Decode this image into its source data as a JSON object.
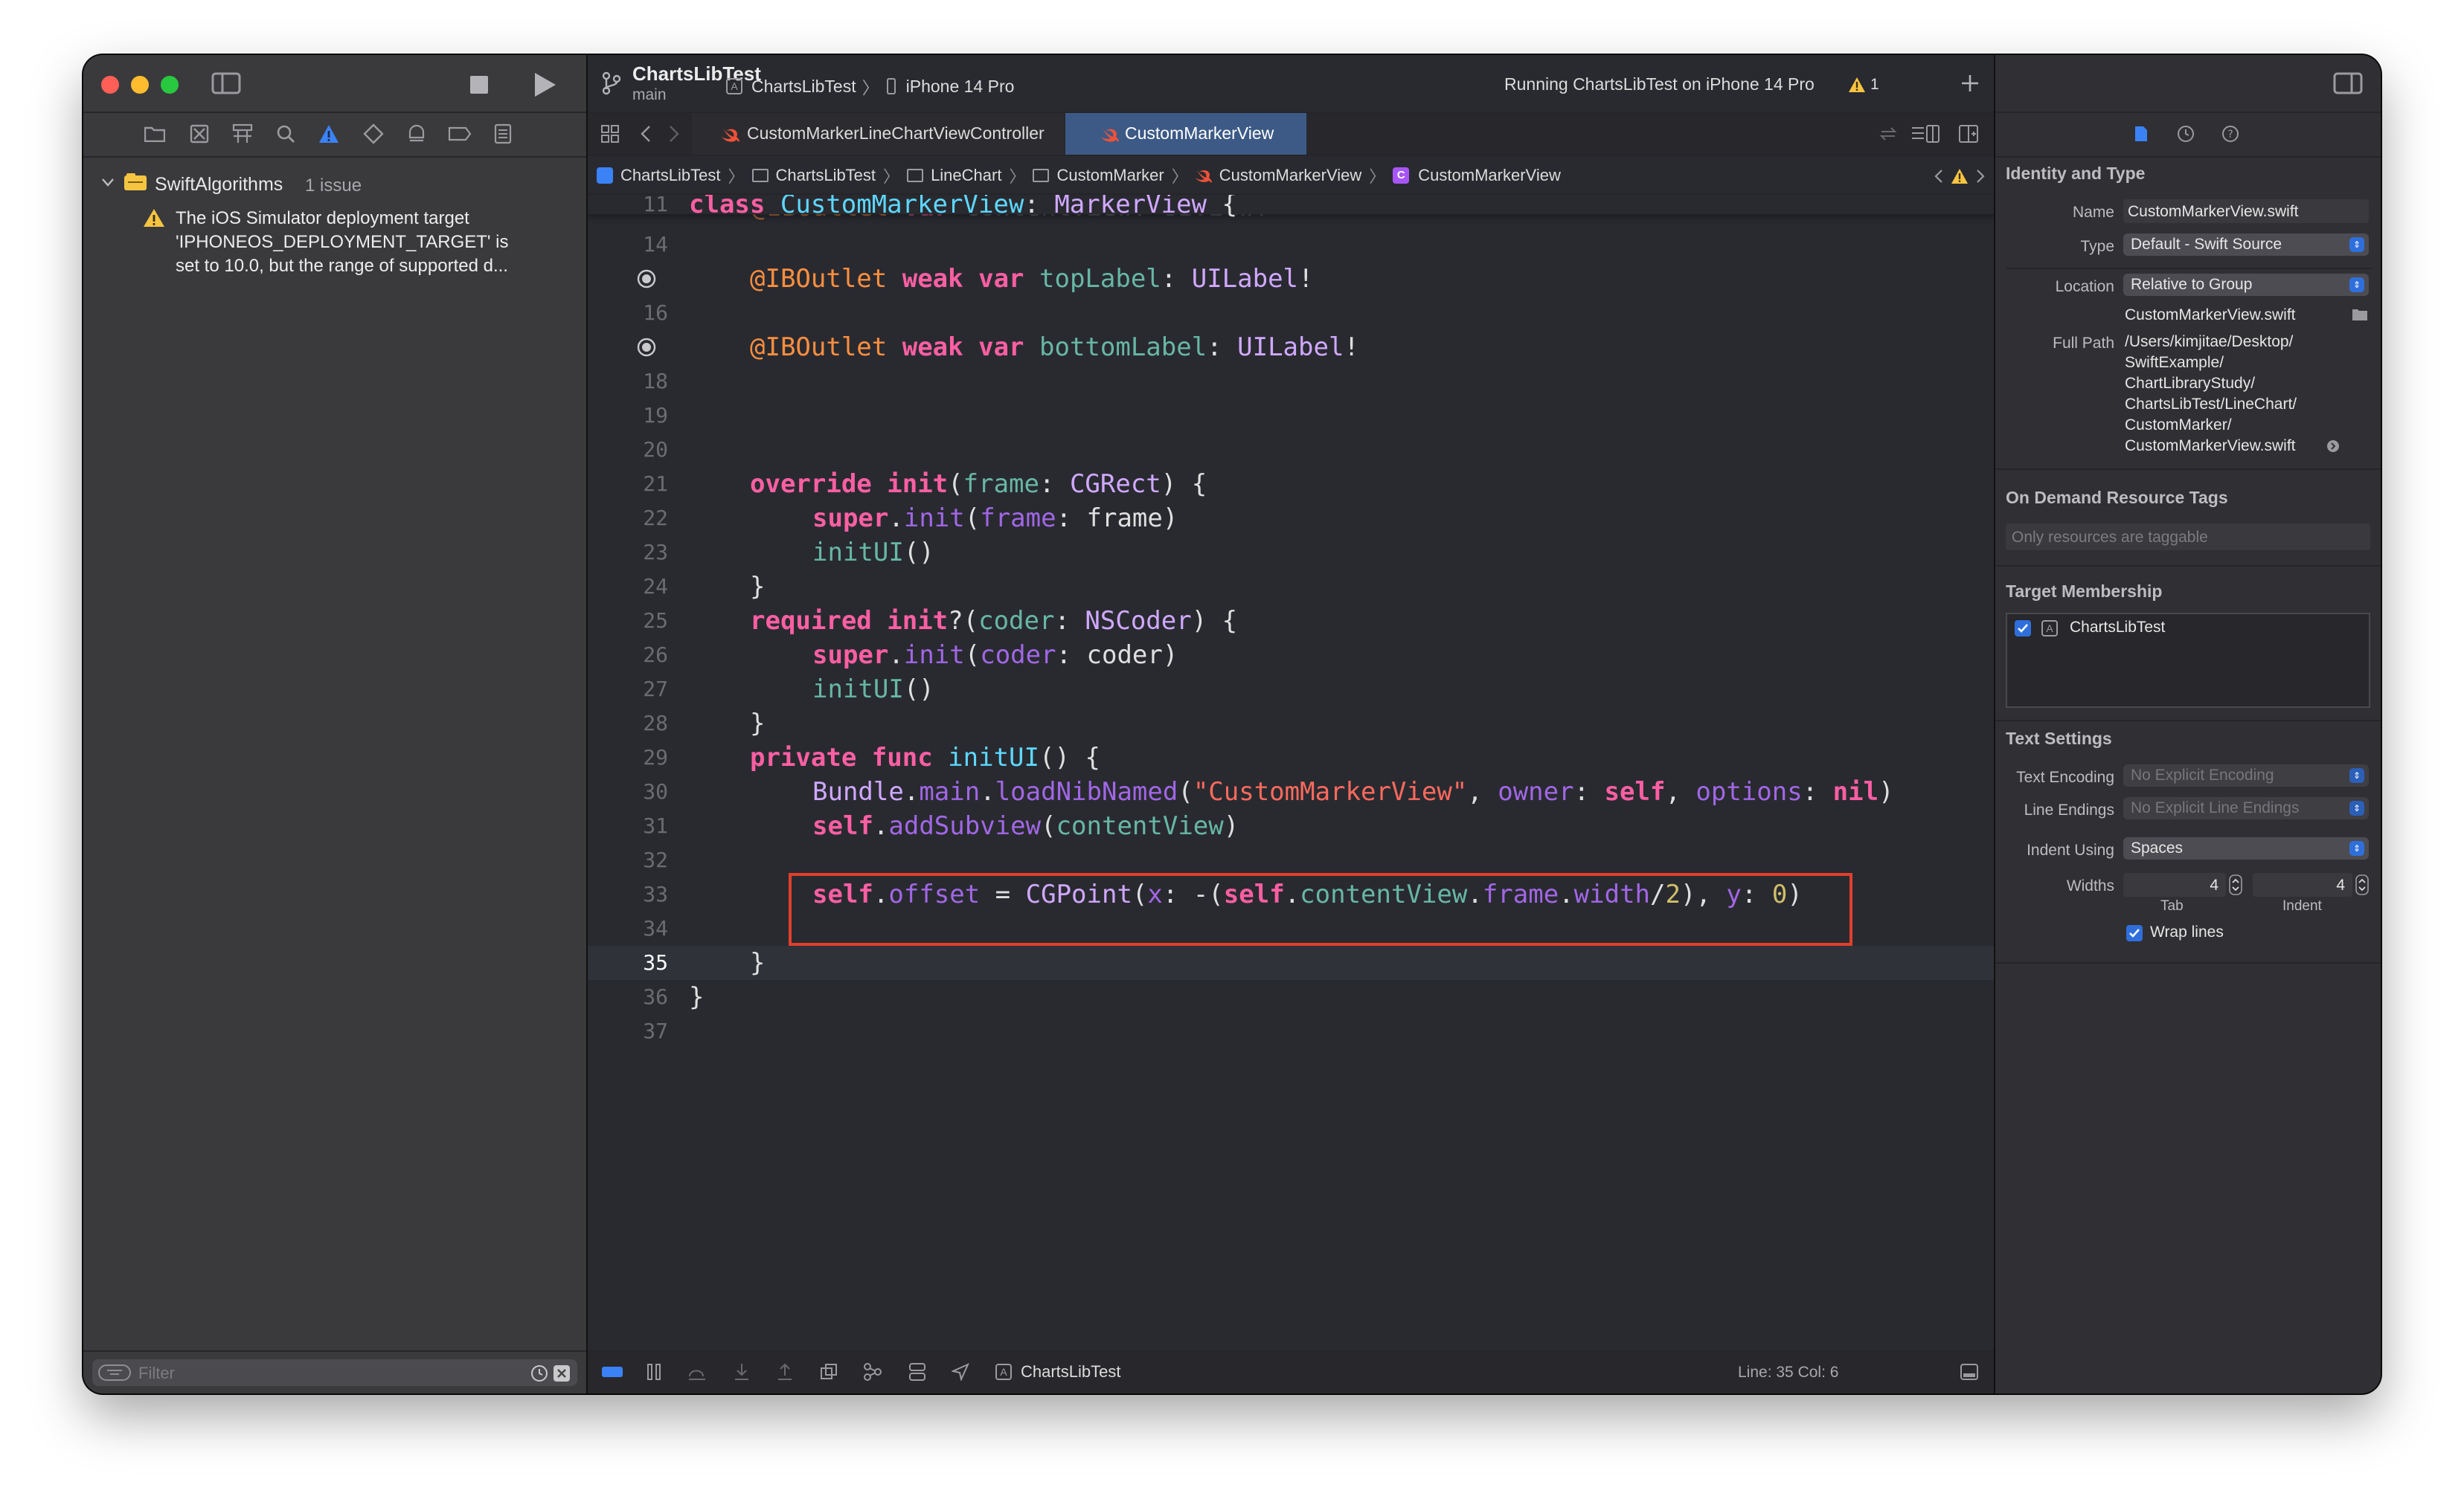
{
  "toolbar": {
    "branch_title": "ChartsLibTest",
    "branch_sub": "main",
    "scheme": "ChartsLibTest",
    "scheme_sep": "〉",
    "device": "iPhone 14 Pro",
    "status": "Running ChartsLibTest on iPhone 14 Pro",
    "warning_count": "1"
  },
  "navigator": {
    "project": "SwiftAlgorithms",
    "issue_count": "1 issue",
    "issue_text_1": "The iOS Simulator deployment target",
    "issue_text_2": "'IPHONEOS_DEPLOYMENT_TARGET' is",
    "issue_text_3": "set to 10.0, but the range of supported d...",
    "filter_placeholder": "Filter"
  },
  "tabs": [
    {
      "label": "CustomMarkerLineChartViewController"
    },
    {
      "label": "CustomMarkerView"
    }
  ],
  "breadcrumb": [
    "ChartsLibTest",
    "ChartsLibTest",
    "LineChart",
    "CustomMarker",
    "CustomMarkerView",
    "CustomMarkerView"
  ],
  "editor": {
    "sticky_ln": "11",
    "cursor_line": "35",
    "status_bar": {
      "scheme": "ChartsLibTest",
      "position": "Line: 35  Col: 6"
    }
  },
  "inspector": {
    "identity_title": "Identity and Type",
    "name_label": "Name",
    "name_value": "CustomMarkerView.swift",
    "type_label": "Type",
    "type_value": "Default - Swift Source",
    "location_label": "Location",
    "location_value": "Relative to Group",
    "file_name": "CustomMarkerView.swift",
    "fullpath_label": "Full Path",
    "fullpath_lines": [
      "/Users/kimjitae/Desktop/",
      "SwiftExample/",
      "ChartLibraryStudy/",
      "ChartsLibTest/LineChart/",
      "CustomMarker/",
      "CustomMarkerView.swift"
    ],
    "ondemand_title": "On Demand Resource Tags",
    "ondemand_placeholder": "Only resources are taggable",
    "target_title": "Target Membership",
    "target_item": "ChartsLibTest",
    "text_settings_title": "Text Settings",
    "encoding_label": "Text Encoding",
    "encoding_value": "No Explicit Encoding",
    "endings_label": "Line Endings",
    "endings_value": "No Explicit Line Endings",
    "indent_label": "Indent Using",
    "indent_value": "Spaces",
    "widths_label": "Widths",
    "tab_value": "4",
    "indent_width_value": "4",
    "tab_label": "Tab",
    "indent_sub_label": "Indent",
    "wrap_label": "Wrap lines"
  },
  "colors": {
    "editor_bg": "#292a30",
    "keyword": "#fc5fa3",
    "type": "#d0a8ff",
    "property": "#67b7a4",
    "string": "#fc6a5d",
    "number": "#d0bf69",
    "highlight_box": "#e0402c",
    "accent": "#2f6fdb"
  }
}
